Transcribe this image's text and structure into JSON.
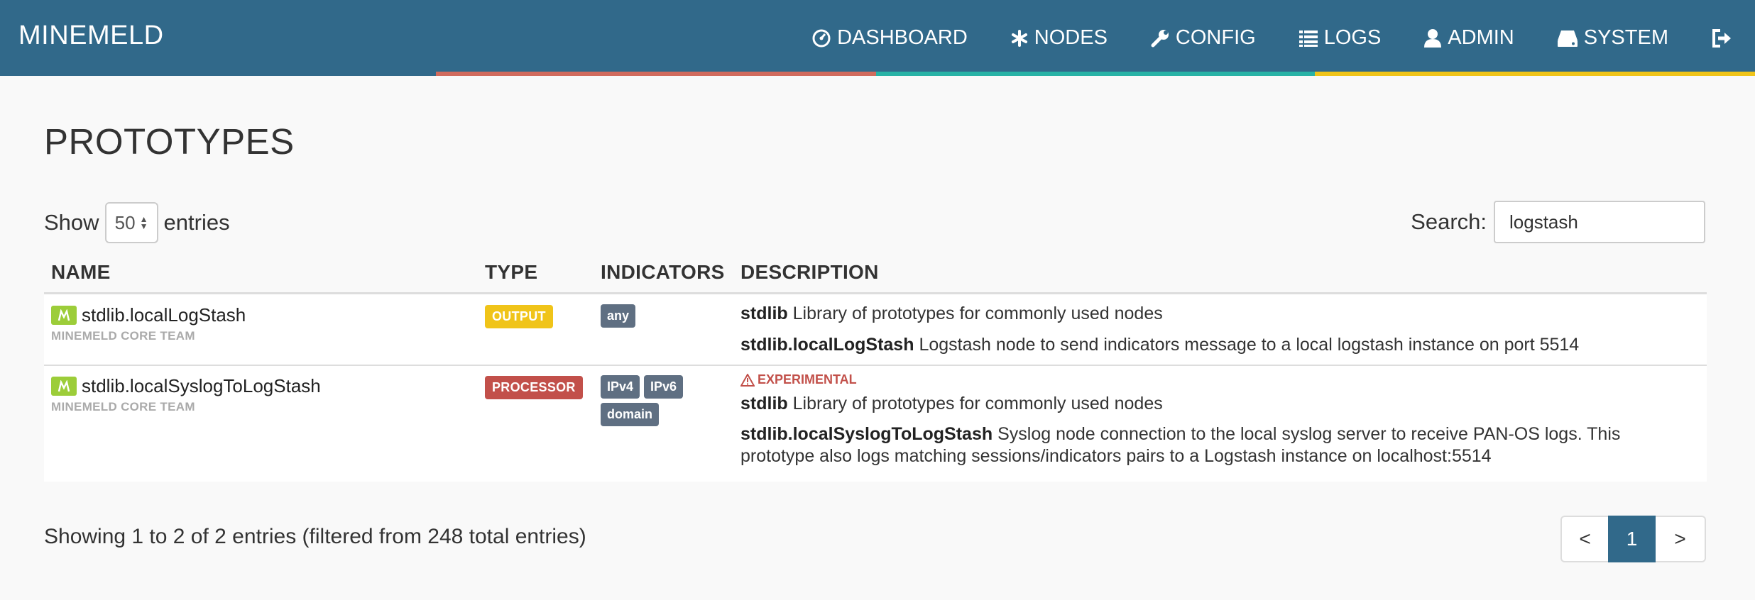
{
  "brand": "MINEMELD",
  "nav": {
    "dashboard": "DASHBOARD",
    "nodes": "NODES",
    "config": "CONFIG",
    "logs": "LOGS",
    "admin": "ADMIN",
    "system": "SYSTEM"
  },
  "page_title": "PROTOTYPES",
  "length": {
    "show": "Show",
    "value": "50",
    "entries": "entries"
  },
  "search": {
    "label": "Search:",
    "value": "logstash"
  },
  "table": {
    "headers": {
      "name": "NAME",
      "type": "TYPE",
      "indicators": "INDICATORS",
      "description": "DESCRIPTION"
    },
    "rows": [
      {
        "name": "stdlib.localLogStash",
        "author": "MINEMELD CORE TEAM",
        "type": "OUTPUT",
        "indicators": [
          "any"
        ],
        "lib_name": "stdlib",
        "lib_desc": "Library of prototypes for commonly used nodes",
        "proto_name": "stdlib.localLogStash",
        "proto_desc": "Logstash node to send indicators message to a local logstash instance on port 5514"
      },
      {
        "name": "stdlib.localSyslogToLogStash",
        "author": "MINEMELD CORE TEAM",
        "type": "PROCESSOR",
        "indicators": [
          "IPv4",
          "IPv6",
          "domain"
        ],
        "flag": "EXPERIMENTAL",
        "lib_name": "stdlib",
        "lib_desc": "Library of prototypes for commonly used nodes",
        "proto_name": "stdlib.localSyslogToLogStash",
        "proto_desc": "Syslog node connection to the local syslog server to receive PAN-OS logs. This",
        "proto_desc_2": "prototype also logs matching sessions/indicators pairs to a Logstash instance on localhost:5514"
      }
    ]
  },
  "info": "Showing 1 to 2 of 2 entries (filtered from 248 total entries)",
  "pagination": {
    "prev": "<",
    "page": "1",
    "next": ">"
  },
  "colors": {
    "navbar": "#31698a",
    "output": "#f0c419",
    "processor": "#c2504a",
    "indicator": "#5f6f82",
    "logo": "#9ccd39"
  }
}
